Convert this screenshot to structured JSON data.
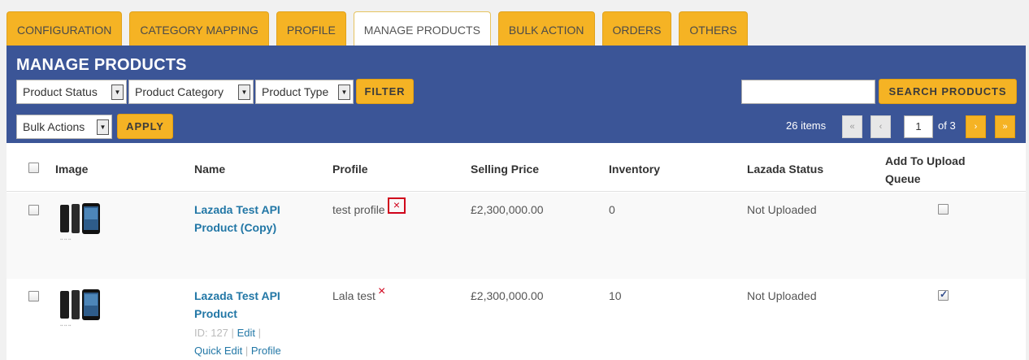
{
  "tabs": [
    {
      "label": "CONFIGURATION"
    },
    {
      "label": "CATEGORY MAPPING"
    },
    {
      "label": "PROFILE"
    },
    {
      "label": "MANAGE PRODUCTS"
    },
    {
      "label": "BULK ACTION"
    },
    {
      "label": "ORDERS"
    },
    {
      "label": "OTHERS"
    }
  ],
  "panel": {
    "title": "MANAGE PRODUCTS",
    "filters": {
      "product_status": "Product Status",
      "product_category": "Product Category",
      "product_type": "Product Type",
      "filter_label": "FILTER"
    },
    "bulk": {
      "selected": "Bulk Actions",
      "apply_label": "APPLY"
    },
    "search": {
      "value": "",
      "button_label": "SEARCH PRODUCTS"
    },
    "pagination": {
      "items": "26 items",
      "first": "«",
      "prev": "‹",
      "current": "1",
      "of_total": "of 3",
      "next": "›",
      "last": "»"
    }
  },
  "table": {
    "headers": {
      "image": "Image",
      "name": "Name",
      "profile": "Profile",
      "selling_price": "Selling Price",
      "inventory": "Inventory",
      "lazada_status": "Lazada Status",
      "add_to_upload_queue_1": "Add To Upload",
      "add_to_upload_queue_2": "Queue"
    },
    "rows": [
      {
        "name_line1": "Lazada Test API",
        "name_line2": "Product (Copy)",
        "profile": "test profile",
        "remove": "×",
        "selling_price": "£2,300,000.00",
        "inventory": "0",
        "lazada_status": "Not Uploaded",
        "queued": false
      },
      {
        "name_line1": "Lazada Test API",
        "name_line2": "Product",
        "id_label": "ID: 127",
        "sep": "|",
        "edit": "Edit",
        "quick_edit": "Quick Edit",
        "profile_link": "Profile",
        "profile": "Lala test",
        "remove": "×",
        "selling_price": "£2,300,000.00",
        "inventory": "10",
        "lazada_status": "Not Uploaded",
        "queued": true
      }
    ]
  },
  "colors": {
    "accent": "#f5b324",
    "panel": "#3b5597",
    "link": "#2277a6",
    "danger": "#d0021b"
  }
}
